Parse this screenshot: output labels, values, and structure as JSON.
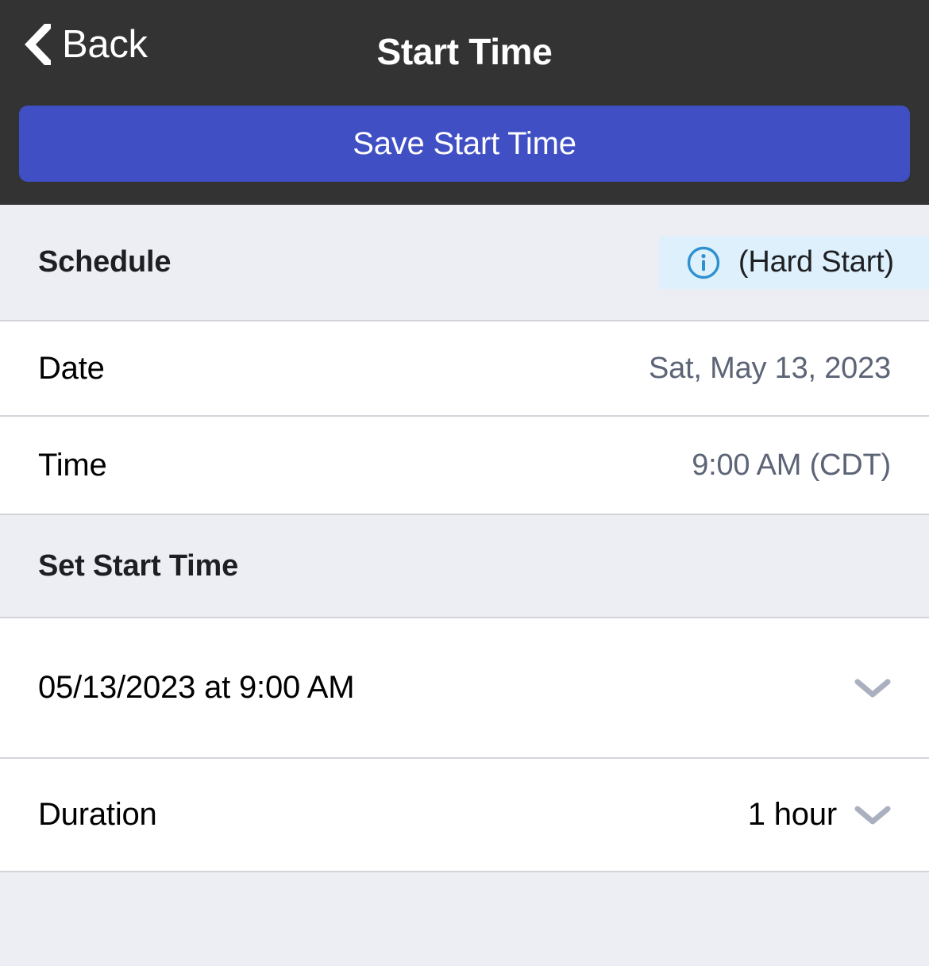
{
  "navbar": {
    "back_label": "Back",
    "title": "Start Time",
    "save_label": "Save Start Time",
    "accent_color": "#4050c4",
    "background_color": "#333333"
  },
  "sections": {
    "schedule": {
      "header": "Schedule",
      "badge": {
        "text": "(Hard Start)",
        "icon": "info-icon",
        "background_color": "#ddf0fc",
        "icon_color": "#2f90cf"
      },
      "rows": [
        {
          "label": "Date",
          "value": "Sat, May 13, 2023"
        },
        {
          "label": "Time",
          "value": "9:00 AM (CDT)"
        }
      ]
    },
    "set_start_time": {
      "header": "Set Start Time",
      "datetime_picker": {
        "value": "05/13/2023 at 9:00 AM",
        "icon": "chevron-down-icon"
      },
      "duration": {
        "label": "Duration",
        "value": "1 hour",
        "icon": "chevron-down-icon"
      }
    }
  }
}
